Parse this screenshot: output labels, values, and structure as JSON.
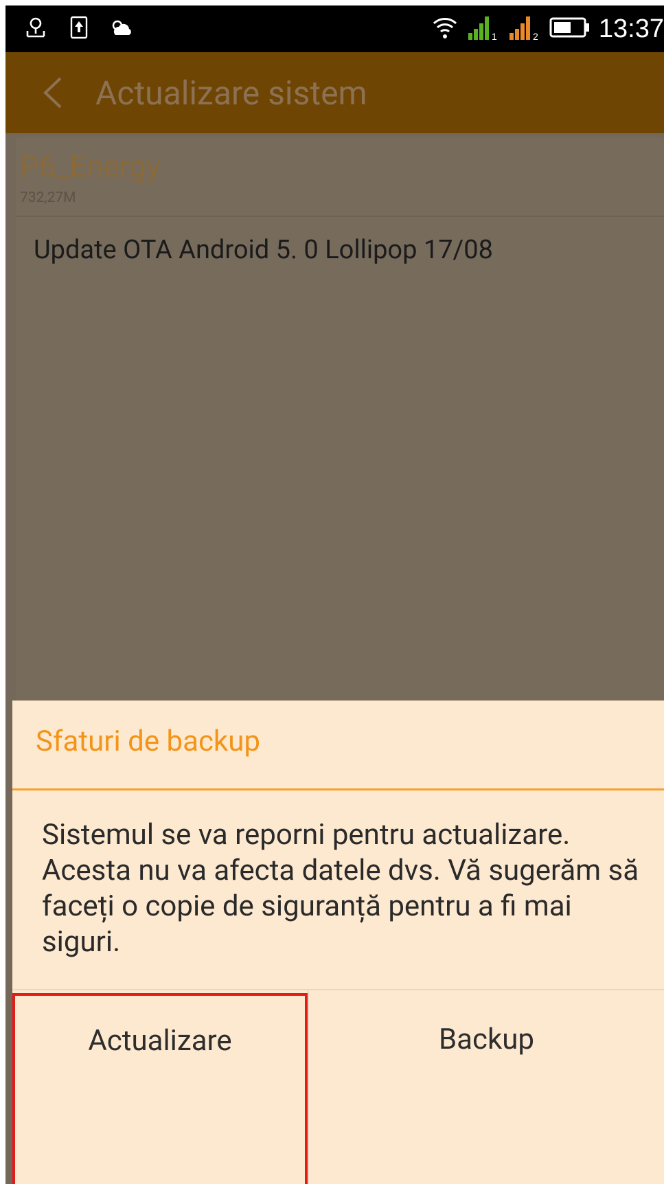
{
  "status_bar": {
    "time": "13:37",
    "icons": [
      "usb-debug-icon",
      "sim-icon",
      "weather-icon",
      "wifi-icon",
      "signal-sim1-icon",
      "signal-sim2-icon",
      "battery-icon"
    ],
    "signal_colors": {
      "sim1": "#5ab31e",
      "sim2": "#e9892a"
    }
  },
  "header": {
    "title": "Actualizare sistem",
    "background": "#6f4503"
  },
  "package": {
    "name": "P6_Energy",
    "size": "732,27M",
    "description": "Update OTA Android 5. 0 Lollipop 17/08"
  },
  "dialog": {
    "title": "Sfaturi de backup",
    "message": "Sistemul se va reporni pentru actualizare. Acesta nu va afecta datele dvs. Vă sugerăm să faceți o copie de siguranță pentru a fi mai siguri.",
    "buttons": {
      "update": "Actualizare",
      "backup": "Backup"
    },
    "accent": "#f39419",
    "highlight": "#e51c16"
  }
}
